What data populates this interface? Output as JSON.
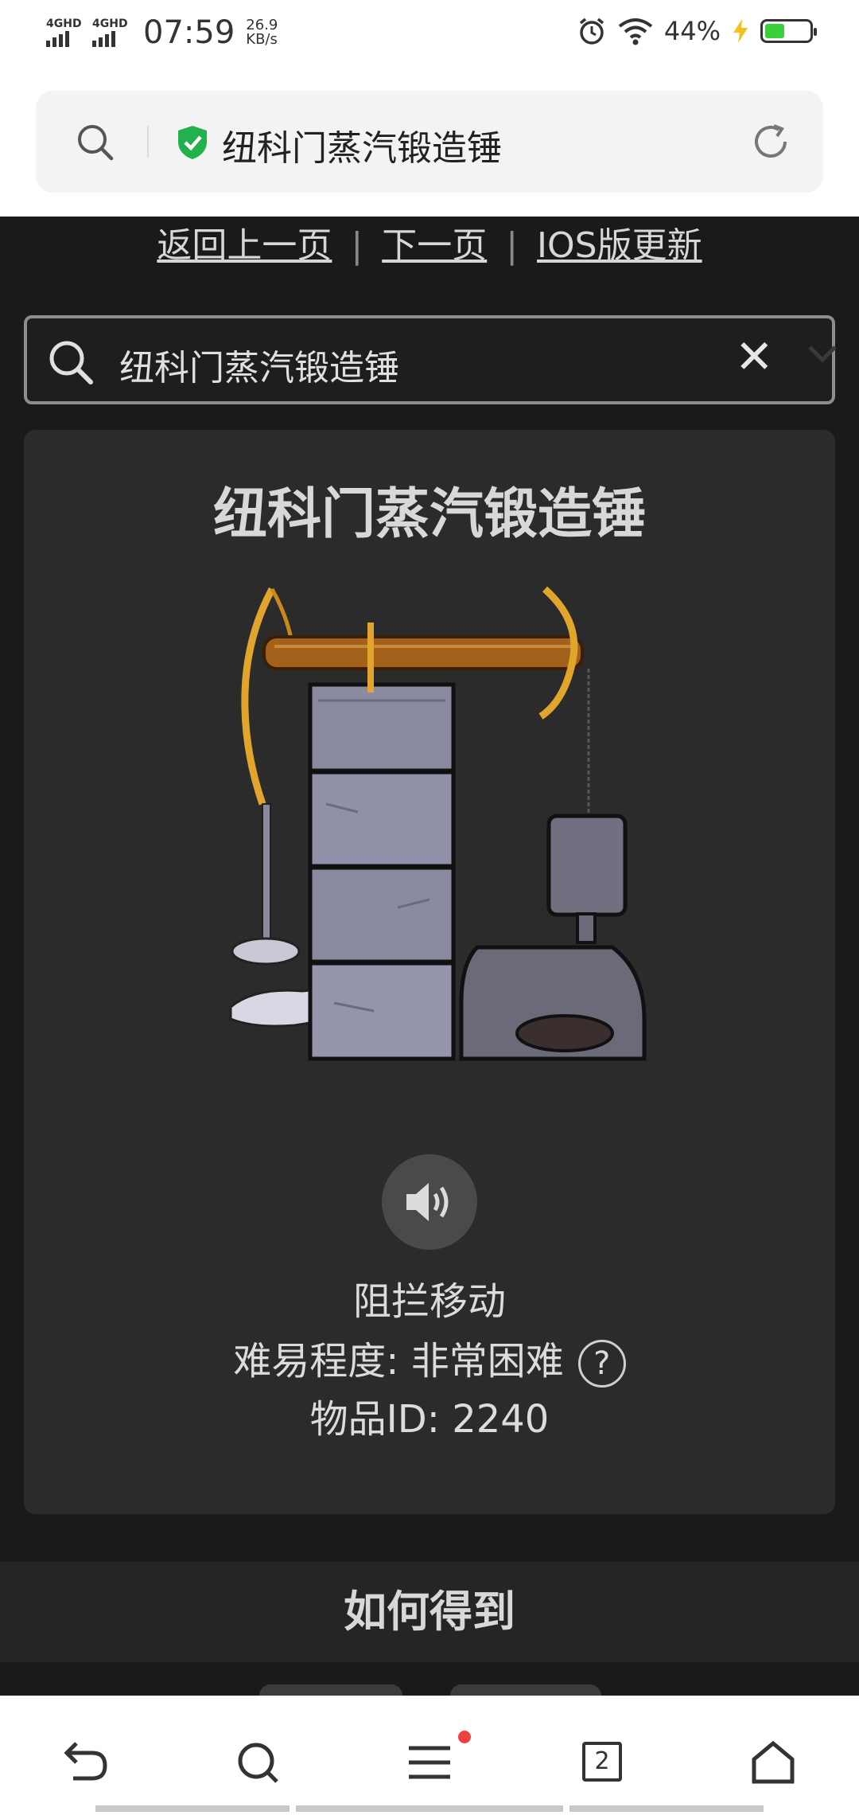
{
  "status_bar": {
    "sim1": "4GHD",
    "sim2": "4GHD",
    "time": "07:59",
    "speed_value": "26.9",
    "speed_unit": "KB/s",
    "battery_pct": "44%"
  },
  "browser": {
    "address_title": "纽科门蒸汽锻造锤"
  },
  "nav_links": {
    "back": "返回上一页",
    "next": "下一页",
    "ios": "IOS版更新",
    "separator": "|"
  },
  "search": {
    "value": "纽科门蒸汽锻造锤",
    "clear": "✕"
  },
  "item": {
    "title": "纽科门蒸汽锻造锤",
    "effect": "阻拦移动",
    "difficulty": "难易程度: 非常困难",
    "help": "?",
    "id_text": "物品ID: 2240"
  },
  "section": {
    "how_to_get": "如何得到"
  },
  "bottom_nav": {
    "tab_count": "2"
  }
}
